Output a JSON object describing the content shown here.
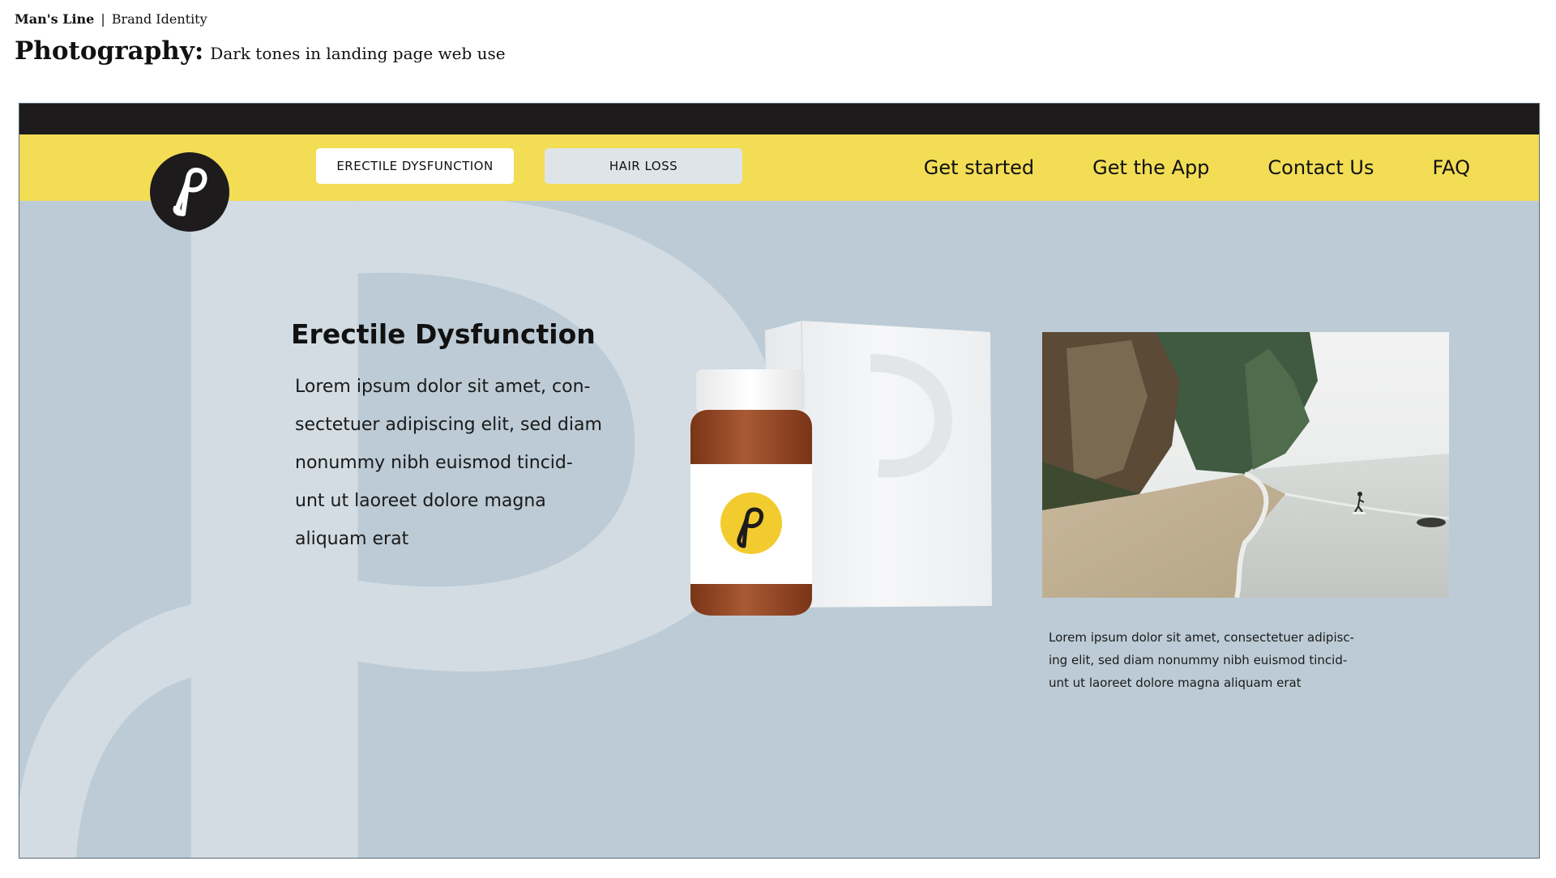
{
  "board": {
    "brand": "Man's Line",
    "separator": "|",
    "section": "Brand Identity",
    "heading": "Photography:",
    "subheading": "Dark tones  in landing page web use"
  },
  "nav": {
    "logo_icon": "p-monogram-icon",
    "tabs": [
      {
        "label": "ERECTILE DYSFUNCTION",
        "active": true
      },
      {
        "label": "HAIR LOSS",
        "active": false
      }
    ],
    "links": [
      "Get started",
      "Get the App",
      "Contact Us",
      "FAQ"
    ]
  },
  "hero": {
    "title": "Erectile Dysfunction",
    "body_lines": [
      "Lorem ipsum dolor sit amet, con-",
      "sectetuer adipiscing elit, sed diam",
      "nonummy nibh euismod tincid-",
      "unt ut laoreet dolore magna",
      "aliquam erat"
    ]
  },
  "product": {
    "label_icon": "p-monogram-icon"
  },
  "photo": {
    "caption_lines": [
      "Lorem ipsum dolor sit amet, consectetuer adipisc-",
      "ing elit, sed diam nonummy nibh euismod tincid-",
      "unt ut laoreet dolore magna aliquam erat"
    ]
  },
  "colors": {
    "accent_yellow": "#f2dd55",
    "background_blue": "#bccbd5",
    "watermark": "#d3dce3",
    "dark": "#1d1b1c",
    "bottle_amber": "#9a4a2a"
  }
}
